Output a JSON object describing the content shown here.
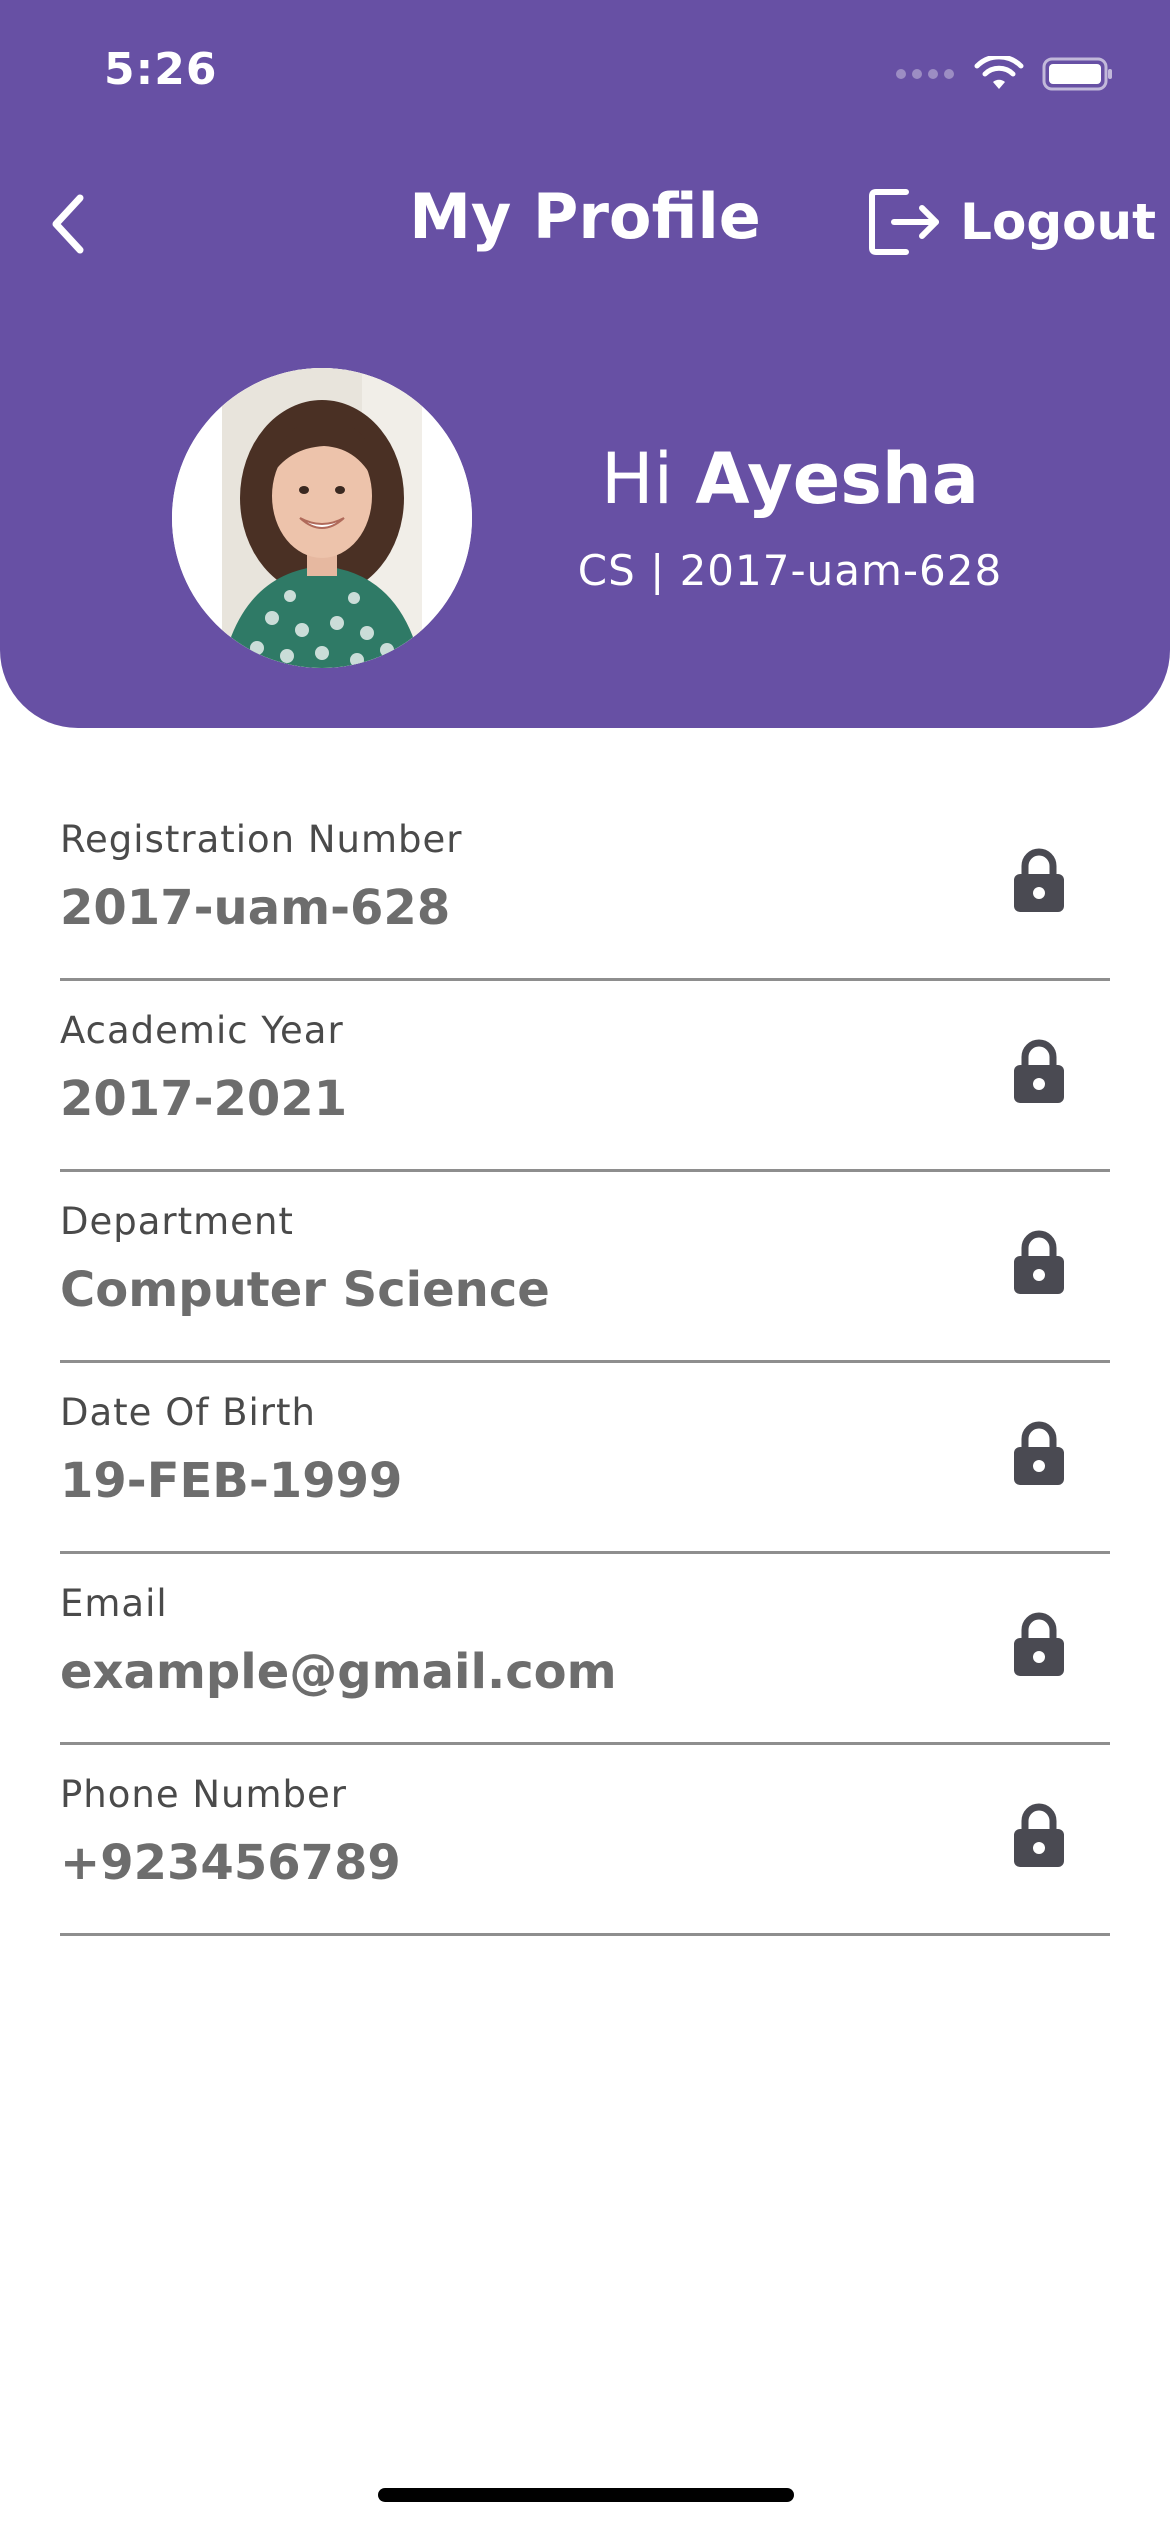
{
  "status_bar": {
    "time": "5:26"
  },
  "header": {
    "title": "My Profile",
    "logout_label": "Logout",
    "background": "#6750a4"
  },
  "profile": {
    "greeting": "Hi",
    "name": "Ayesha",
    "subtitle": "CS | 2017-uam-628"
  },
  "fields": [
    {
      "label": "Registration Number",
      "value": "2017-uam-628",
      "icon": "lock-icon"
    },
    {
      "label": "Academic Year",
      "value": "2017-2021",
      "icon": "lock-icon"
    },
    {
      "label": "Department",
      "value": "Computer Science",
      "icon": "lock-icon"
    },
    {
      "label": "Date Of Birth",
      "value": "19-FEB-1999",
      "icon": "lock-icon"
    },
    {
      "label": "Email",
      "value": "example@gmail.com",
      "icon": "lock-icon"
    },
    {
      "label": "Phone Number",
      "value": "+923456789",
      "icon": "lock-icon"
    }
  ],
  "colors": {
    "accent": "#6750a4",
    "label_text": "#4a4a4a",
    "value_text": "#6d6d6d",
    "lock": "#4a4a52",
    "divider": "#8e8e8e"
  }
}
